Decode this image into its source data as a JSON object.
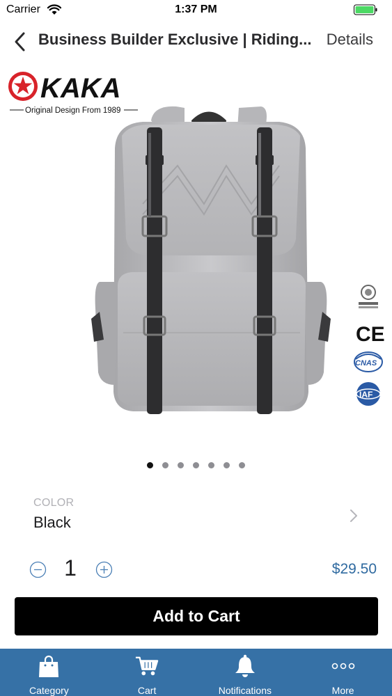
{
  "status_bar": {
    "carrier": "Carrier",
    "time": "1:37 PM"
  },
  "nav": {
    "title": "Business Builder Exclusive | Riding...",
    "details_label": "Details",
    "back_icon": "chevron-left-icon"
  },
  "product_image": {
    "brand_logo": "KAKA",
    "brand_tagline": "Original Design From 1989",
    "cert_icons": [
      "bureau-veritas-icon",
      "ce-icon",
      "cnas-icon",
      "iaf-icon"
    ],
    "page_count": 7,
    "active_page": 1
  },
  "color": {
    "label": "COLOR",
    "value": "Black"
  },
  "quantity": {
    "value": "1",
    "minus_icon": "minus-circle-icon",
    "plus_icon": "plus-circle-icon"
  },
  "price": "$29.50",
  "add_to_cart_label": "Add to Cart",
  "tabs": [
    {
      "label": "Category",
      "icon": "shopping-bag-icon"
    },
    {
      "label": "Cart",
      "icon": "cart-icon"
    },
    {
      "label": "Notifications",
      "icon": "bell-icon"
    },
    {
      "label": "More",
      "icon": "more-dots-icon"
    }
  ],
  "colors": {
    "tab_bar": "#3671a6",
    "price": "#2f6aa0",
    "button": "#000000",
    "battery": "#4cd964"
  }
}
